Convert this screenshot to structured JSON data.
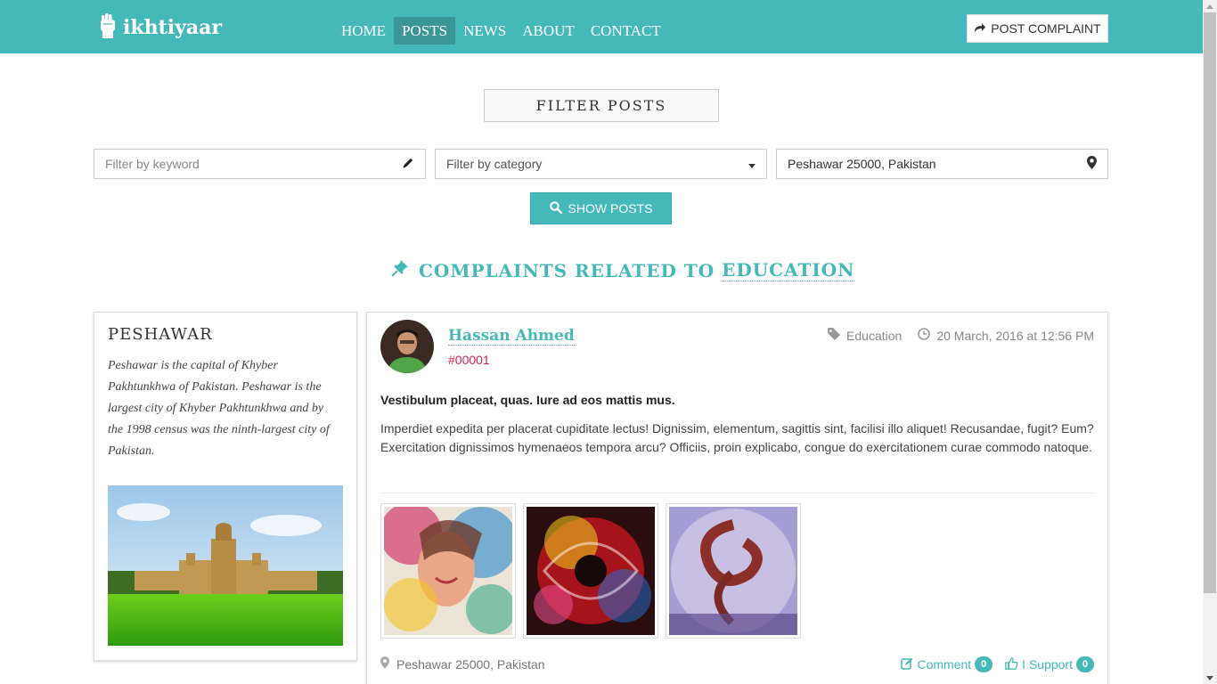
{
  "brand": {
    "name": "ikhtiyaar"
  },
  "nav": {
    "items": [
      {
        "label": "HOME"
      },
      {
        "label": "POSTS"
      },
      {
        "label": "NEWS"
      },
      {
        "label": "ABOUT"
      },
      {
        "label": "CONTACT"
      }
    ],
    "active": "POSTS"
  },
  "header": {
    "post_complaint_label": "POST COMPLAINT"
  },
  "filter": {
    "title": "FILTER POSTS",
    "keyword_placeholder": "Filter by keyword",
    "category_selected": "Filter by category",
    "location_value": "Peshawar 25000, Pakistan",
    "show_button_label": "SHOW POSTS"
  },
  "heading": {
    "prefix": "COMPLAINTS RELATED TO",
    "category": "EDUCATION"
  },
  "city": {
    "name": "PESHAWAR",
    "description": "Peshawar is the capital of Khyber Pakhtunkhwa of Pakistan. Peshawar is the largest city of Khyber Pakhtunkhwa and by the 1998 census was the ninth-largest city of Pakistan."
  },
  "post": {
    "author": "Hassan Ahmed",
    "id": "#00001",
    "category": "Education",
    "date": "20 March, 2016 at 12:56 PM",
    "lead": "Vestibulum placeat, quas. Iure ad eos mattis mus.",
    "body": "Imperdiet expedita per placerat cupiditate lectus! Dignissim, elementum, sagittis sint, facilisi illo aliquet! Recusandae, fugit? Eum? Exercitation dignissimos hymenaeos tempora arcu? Officiis, proin explicabo, congue do exercitationem curae commodo natoque.",
    "location": "Peshawar 25000, Pakistan",
    "comment_label": "Comment",
    "comment_count": "0",
    "support_label": "I Support",
    "support_count": "0"
  },
  "colors": {
    "accent": "#45b9ba",
    "accent_dark": "#3a9697",
    "post_id": "#d9224c"
  },
  "icons": [
    "fist-icon",
    "share-arrow-icon",
    "pencil-icon",
    "caret-down-icon",
    "map-marker-icon",
    "search-icon",
    "pin-icon",
    "tag-icon",
    "clock-icon",
    "edit-icon",
    "thumbs-up-icon"
  ]
}
